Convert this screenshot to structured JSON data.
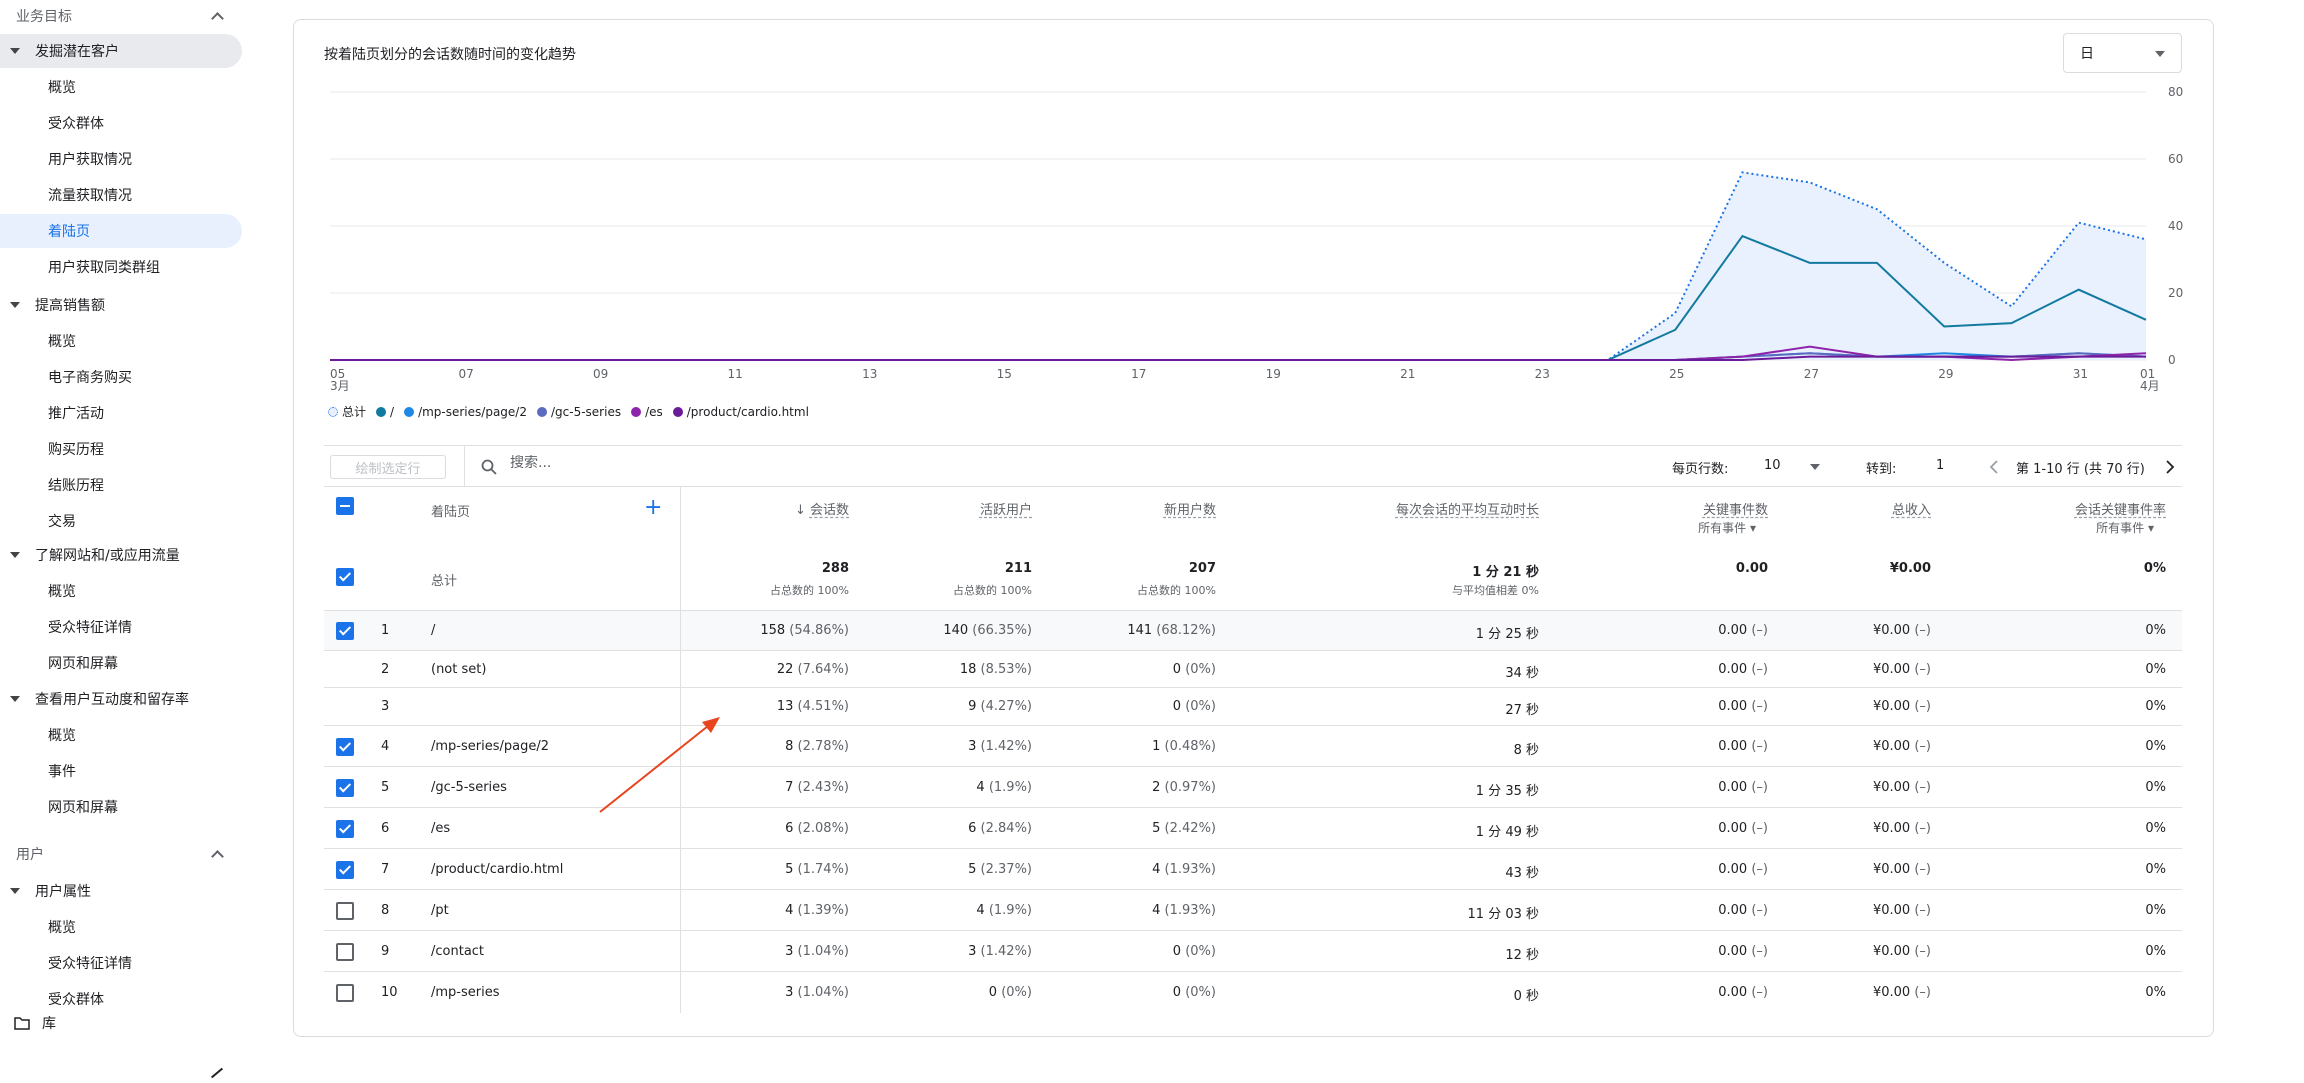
{
  "sidebar": {
    "sections": [
      {
        "label": "业务目标"
      },
      {
        "label": "用户"
      }
    ],
    "groups": [
      {
        "label": "发掘潜在客户",
        "items": [
          "概览",
          "受众群体",
          "用户获取情况",
          "流量获取情况",
          "着陆页",
          "用户获取同类群组"
        ]
      },
      {
        "label": "提高销售额",
        "items": [
          "概览",
          "电子商务购买",
          "推广活动",
          "购买历程",
          "结账历程",
          "交易"
        ]
      },
      {
        "label": "了解网站和/或应用流量",
        "items": [
          "概览",
          "受众特征详情",
          "网页和屏幕"
        ]
      },
      {
        "label": "查看用户互动度和留存率",
        "items": [
          "概览",
          "事件",
          "网页和屏幕"
        ]
      },
      {
        "label": "用户属性",
        "items": [
          "概览",
          "受众特征详情",
          "受众群体"
        ]
      }
    ],
    "library_label": "库"
  },
  "chart_title": "按着陆页划分的会话数随时间的变化趋势",
  "granularity": "日",
  "chart_data": {
    "type": "line",
    "x": [
      "03-05",
      "03-06",
      "03-07",
      "03-08",
      "03-09",
      "03-10",
      "03-11",
      "03-12",
      "03-13",
      "03-14",
      "03-15",
      "03-16",
      "03-17",
      "03-18",
      "03-19",
      "03-20",
      "03-21",
      "03-22",
      "03-23",
      "03-24",
      "03-25",
      "03-26",
      "03-27",
      "03-28",
      "03-29",
      "03-30",
      "03-31",
      "04-01"
    ],
    "x_tick_labels": [
      "05\n3月",
      "07",
      "09",
      "11",
      "13",
      "15",
      "17",
      "19",
      "21",
      "23",
      "25",
      "27",
      "29",
      "31",
      "01\n4月"
    ],
    "ylim": [
      0,
      80
    ],
    "y_ticks": [
      0,
      20,
      40,
      60,
      80
    ],
    "y_axis_side": "right",
    "grid": true,
    "series": [
      {
        "name": "总计",
        "color": "#1a73e8",
        "style": "dotted-area",
        "values": [
          0,
          0,
          0,
          0,
          0,
          0,
          0,
          0,
          0,
          0,
          0,
          0,
          0,
          0,
          0,
          0,
          0,
          0,
          0,
          0,
          14,
          56,
          53,
          45,
          29,
          16,
          41,
          36
        ]
      },
      {
        "name": "/",
        "color": "#137a9f",
        "style": "line",
        "values": [
          0,
          0,
          0,
          0,
          0,
          0,
          0,
          0,
          0,
          0,
          0,
          0,
          0,
          0,
          0,
          0,
          0,
          0,
          0,
          0,
          9,
          37,
          29,
          29,
          10,
          11,
          21,
          12
        ]
      },
      {
        "name": "/mp-series/page/2",
        "color": "#1e88e5",
        "style": "line",
        "values": [
          0,
          0,
          0,
          0,
          0,
          0,
          0,
          0,
          0,
          0,
          0,
          0,
          0,
          0,
          0,
          0,
          0,
          0,
          0,
          0,
          0,
          1,
          2,
          1,
          2,
          1,
          2,
          1
        ]
      },
      {
        "name": "/gc-5-series",
        "color": "#5c6bc0",
        "style": "line",
        "values": [
          0,
          0,
          0,
          0,
          0,
          0,
          0,
          0,
          0,
          0,
          0,
          0,
          0,
          0,
          0,
          0,
          0,
          0,
          0,
          0,
          0,
          1,
          2,
          1,
          1,
          1,
          2,
          1
        ]
      },
      {
        "name": "/es",
        "color": "#8e24aa",
        "style": "line",
        "values": [
          0,
          0,
          0,
          0,
          0,
          0,
          0,
          0,
          0,
          0,
          0,
          0,
          0,
          0,
          0,
          0,
          0,
          0,
          0,
          0,
          0,
          1,
          4,
          1,
          1,
          0,
          1,
          2
        ]
      },
      {
        "name": "/product/cardio.html",
        "color": "#6a1b9a",
        "style": "line",
        "values": [
          0,
          0,
          0,
          0,
          0,
          0,
          0,
          0,
          0,
          0,
          0,
          0,
          0,
          0,
          0,
          0,
          0,
          0,
          0,
          0,
          0,
          0,
          1,
          1,
          1,
          1,
          1,
          1
        ]
      }
    ],
    "legend_position": "bottom-left"
  },
  "toolbar": {
    "plot_button": "绘制选定行",
    "search_placeholder": "搜索...",
    "rows_per_page_label": "每页行数:",
    "rows_per_page": "10",
    "goto_label": "转到:",
    "goto_value": "1",
    "page_info": "第 1-10 行 (共 70 行)"
  },
  "table": {
    "columns": {
      "dimension": "着陆页",
      "sessions": "会话数",
      "active_users": "活跃用户",
      "new_users": "新用户数",
      "avg_engagement": "每次会话的平均互动时长",
      "key_events": "关键事件数",
      "key_events_sub": "所有事件",
      "revenue": "总收入",
      "key_event_rate": "会话关键事件率",
      "key_event_rate_sub": "所有事件"
    },
    "totals": {
      "label": "总计",
      "sessions": "288",
      "sessions_sub": "占总数的 100%",
      "active_users": "211",
      "active_users_sub": "占总数的 100%",
      "new_users": "207",
      "new_users_sub": "占总数的 100%",
      "avg_engagement": "1 分 21 秒",
      "avg_engagement_sub": "与平均值相差 0%",
      "key_events": "0.00",
      "revenue": "¥0.00",
      "key_event_rate": "0%"
    },
    "rows": [
      {
        "idx": "1",
        "page": "/",
        "checked": true,
        "sessions": "158",
        "sessions_pct": "(54.86%)",
        "active": "140",
        "active_pct": "(66.35%)",
        "new": "141",
        "new_pct": "(68.12%)",
        "avg": "1 分 25 秒",
        "key_events": "0.00",
        "key_events_pct": "(–)",
        "revenue": "¥0.00",
        "revenue_pct": "(–)",
        "rate": "0%"
      },
      {
        "idx": "2",
        "page": "(not set)",
        "checked": null,
        "sessions": "22",
        "sessions_pct": "(7.64%)",
        "active": "18",
        "active_pct": "(8.53%)",
        "new": "0",
        "new_pct": "(0%)",
        "avg": "34 秒",
        "key_events": "0.00",
        "key_events_pct": "(–)",
        "revenue": "¥0.00",
        "revenue_pct": "(–)",
        "rate": "0%"
      },
      {
        "idx": "3",
        "page": "",
        "checked": null,
        "sessions": "13",
        "sessions_pct": "(4.51%)",
        "active": "9",
        "active_pct": "(4.27%)",
        "new": "0",
        "new_pct": "(0%)",
        "avg": "27 秒",
        "key_events": "0.00",
        "key_events_pct": "(–)",
        "revenue": "¥0.00",
        "revenue_pct": "(–)",
        "rate": "0%"
      },
      {
        "idx": "4",
        "page": "/mp-series/page/2",
        "checked": true,
        "sessions": "8",
        "sessions_pct": "(2.78%)",
        "active": "3",
        "active_pct": "(1.42%)",
        "new": "1",
        "new_pct": "(0.48%)",
        "avg": "8 秒",
        "key_events": "0.00",
        "key_events_pct": "(–)",
        "revenue": "¥0.00",
        "revenue_pct": "(–)",
        "rate": "0%"
      },
      {
        "idx": "5",
        "page": "/gc-5-series",
        "checked": true,
        "sessions": "7",
        "sessions_pct": "(2.43%)",
        "active": "4",
        "active_pct": "(1.9%)",
        "new": "2",
        "new_pct": "(0.97%)",
        "avg": "1 分 35 秒",
        "key_events": "0.00",
        "key_events_pct": "(–)",
        "revenue": "¥0.00",
        "revenue_pct": "(–)",
        "rate": "0%"
      },
      {
        "idx": "6",
        "page": "/es",
        "checked": true,
        "sessions": "6",
        "sessions_pct": "(2.08%)",
        "active": "6",
        "active_pct": "(2.84%)",
        "new": "5",
        "new_pct": "(2.42%)",
        "avg": "1 分 49 秒",
        "key_events": "0.00",
        "key_events_pct": "(–)",
        "revenue": "¥0.00",
        "revenue_pct": "(–)",
        "rate": "0%"
      },
      {
        "idx": "7",
        "page": "/product/cardio.html",
        "checked": true,
        "sessions": "5",
        "sessions_pct": "(1.74%)",
        "active": "5",
        "active_pct": "(2.37%)",
        "new": "4",
        "new_pct": "(1.93%)",
        "avg": "43 秒",
        "key_events": "0.00",
        "key_events_pct": "(–)",
        "revenue": "¥0.00",
        "revenue_pct": "(–)",
        "rate": "0%"
      },
      {
        "idx": "8",
        "page": "/pt",
        "checked": false,
        "sessions": "4",
        "sessions_pct": "(1.39%)",
        "active": "4",
        "active_pct": "(1.9%)",
        "new": "4",
        "new_pct": "(1.93%)",
        "avg": "11 分 03 秒",
        "key_events": "0.00",
        "key_events_pct": "(–)",
        "revenue": "¥0.00",
        "revenue_pct": "(–)",
        "rate": "0%"
      },
      {
        "idx": "9",
        "page": "/contact",
        "checked": false,
        "sessions": "3",
        "sessions_pct": "(1.04%)",
        "active": "3",
        "active_pct": "(1.42%)",
        "new": "0",
        "new_pct": "(0%)",
        "avg": "12 秒",
        "key_events": "0.00",
        "key_events_pct": "(–)",
        "revenue": "¥0.00",
        "revenue_pct": "(–)",
        "rate": "0%"
      },
      {
        "idx": "10",
        "page": "/mp-series",
        "checked": false,
        "sessions": "3",
        "sessions_pct": "(1.04%)",
        "active": "0",
        "active_pct": "(0%)",
        "new": "0",
        "new_pct": "(0%)",
        "avg": "0 秒",
        "key_events": "0.00",
        "key_events_pct": "(–)",
        "revenue": "¥0.00",
        "revenue_pct": "(–)",
        "rate": "0%"
      }
    ]
  },
  "colors": {
    "accent": "#1a73e8",
    "annotation_arrow": "#e8451e"
  }
}
